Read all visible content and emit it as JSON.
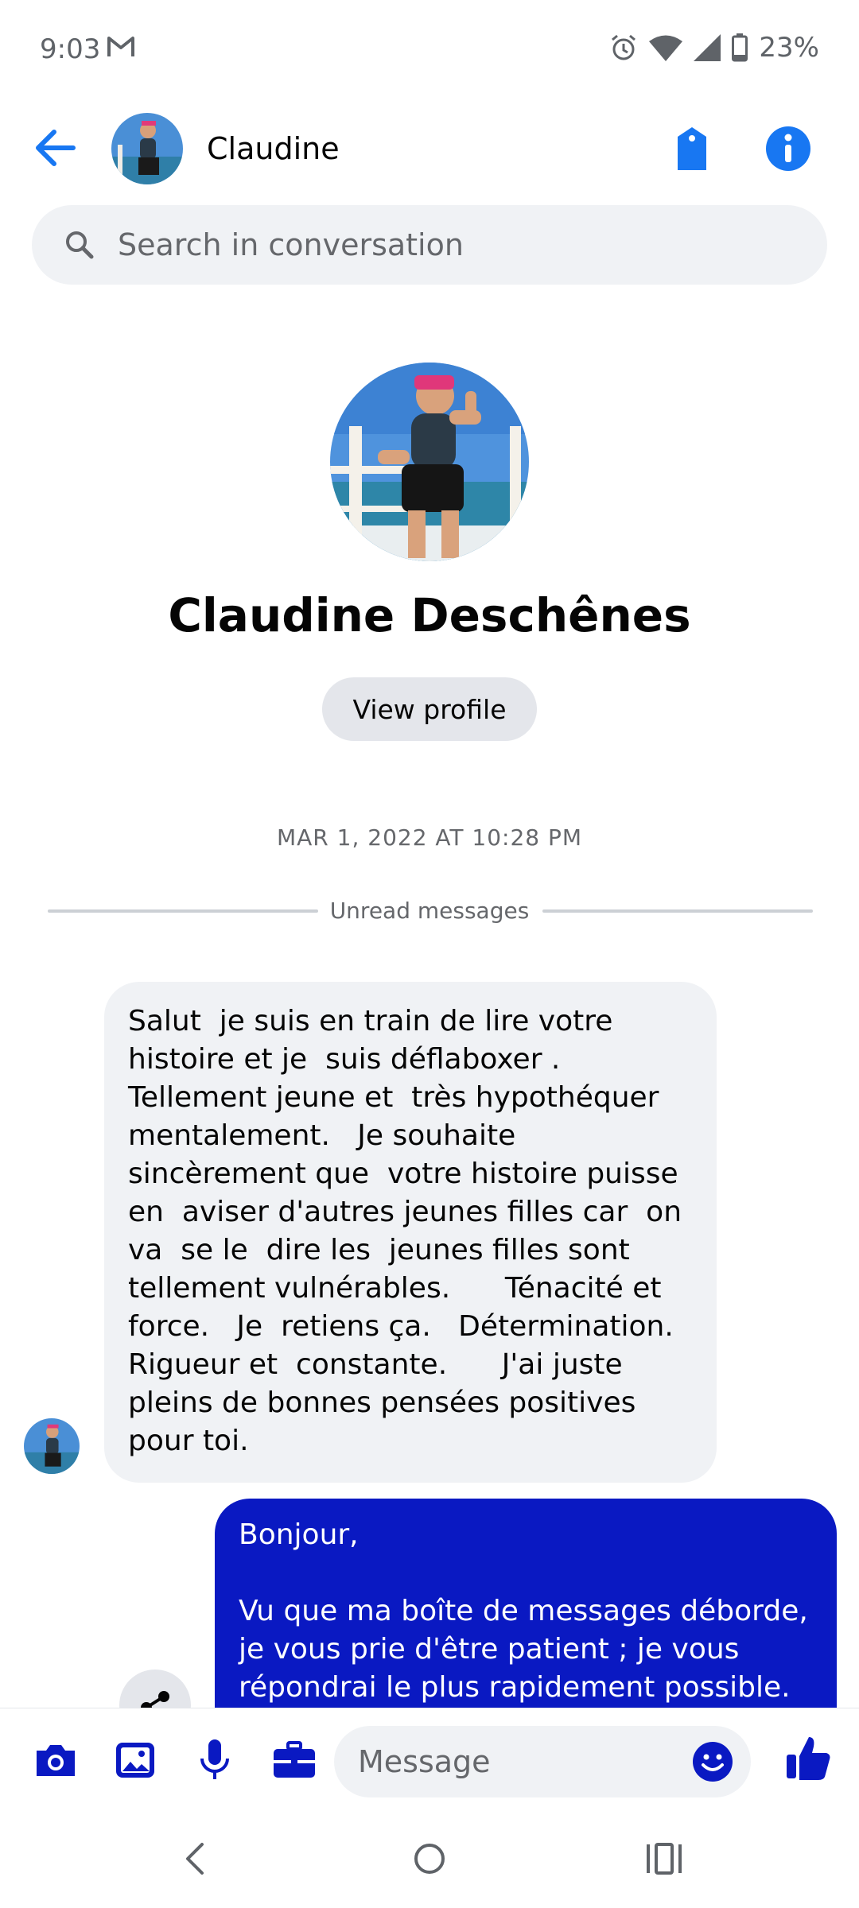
{
  "status_bar": {
    "time": "9:03",
    "battery": "23%"
  },
  "header": {
    "contact_name": "Claudine"
  },
  "search": {
    "placeholder": "Search in conversation"
  },
  "profile": {
    "full_name": "Claudine Deschênes",
    "view_profile_label": "View profile"
  },
  "thread": {
    "timestamp": "MAR 1, 2022 AT 10:28 PM",
    "unread_label": "Unread messages",
    "incoming_message": "Salut  je suis en train de lire votre histoire et je  suis déflaboxer .    Tellement jeune et  très hypothéquer mentalement.   Je souhaite sincèrement que  votre histoire puisse en  aviser d'autres jeunes filles car  on va  se le  dire les  jeunes filles sont tellement vulnérables.      Ténacité et force.   Je  retiens ça.   Détermination.  Rigueur et  constante.      J'ai juste pleins de bonnes pensées positives pour toi.",
    "outgoing_message": "Bonjour,\n\nVu que ma boîte de messages déborde, je vous prie d'être patient ; je vous répondrai le plus rapidement possible."
  },
  "composer": {
    "placeholder": "Message"
  },
  "colors": {
    "accent": "#0a19c2",
    "link_blue": "#1877f2",
    "bubble_gray": "#f0f2f5"
  },
  "icons": [
    "mail-icon",
    "alarm-icon",
    "wifi-icon",
    "signal-icon",
    "battery-icon",
    "back-arrow-icon",
    "tag-icon",
    "info-icon",
    "search-icon",
    "share-icon",
    "camera-icon",
    "gallery-icon",
    "microphone-icon",
    "briefcase-icon",
    "emoji-icon",
    "thumbs-up-icon",
    "nav-back-icon",
    "nav-home-icon",
    "nav-recents-icon"
  ]
}
